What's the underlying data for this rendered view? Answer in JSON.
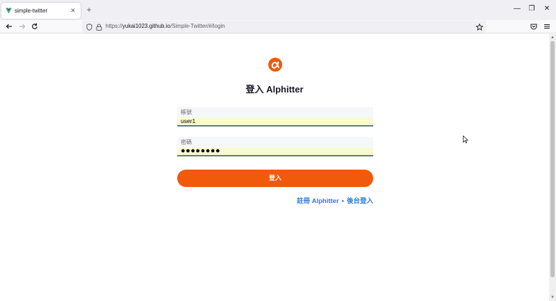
{
  "browser": {
    "tab_title": "simple-twitter",
    "url_scheme": "https://",
    "url_host": "yukai1023.github.io",
    "url_path": "/Simple-Twitter/#/login"
  },
  "login": {
    "title": "登入 Alphitter",
    "account_label": "帳號",
    "account_value": "user1",
    "password_label": "密碼",
    "password_value": "●●●●●●●●",
    "submit_label": "登入",
    "register_link": "註冊 Alphitter",
    "separator": "•",
    "admin_link": "後台登入"
  },
  "colors": {
    "accent": "#f05a0a",
    "link": "#2f7cd8",
    "autofill": "#fafad2"
  }
}
